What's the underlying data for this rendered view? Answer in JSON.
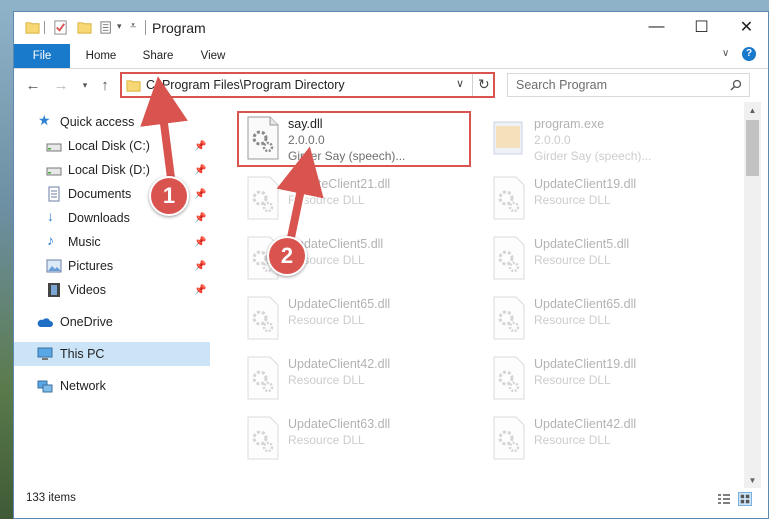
{
  "window": {
    "title": "Program",
    "controls": {
      "minimize": "—",
      "maximize": "☐",
      "close": "✕"
    }
  },
  "ribbon": {
    "tabs": [
      "File",
      "Home",
      "Share",
      "View"
    ]
  },
  "address": {
    "path": "C:\\Program Files\\Program Directory",
    "search_placeholder": "Search Program"
  },
  "sidebar": {
    "items": [
      {
        "label": "Quick access",
        "icon": "star-icon",
        "pinned": false
      },
      {
        "label": "Local Disk (C:)",
        "icon": "drive-icon",
        "pinned": true
      },
      {
        "label": "Local Disk (D:)",
        "icon": "drive-icon",
        "pinned": true
      },
      {
        "label": "Documents",
        "icon": "documents-icon",
        "pinned": true
      },
      {
        "label": "Downloads",
        "icon": "downloads-icon",
        "pinned": true
      },
      {
        "label": "Music",
        "icon": "music-icon",
        "pinned": true
      },
      {
        "label": "Pictures",
        "icon": "pictures-icon",
        "pinned": true
      },
      {
        "label": "Videos",
        "icon": "videos-icon",
        "pinned": true
      },
      {
        "label": "OneDrive",
        "icon": "onedrive-icon",
        "pinned": false
      },
      {
        "label": "This PC",
        "icon": "this-pc-icon",
        "pinned": false
      },
      {
        "label": "Network",
        "icon": "network-icon",
        "pinned": false
      }
    ]
  },
  "files": {
    "highlighted": {
      "name": "say.dll",
      "version": "2.0.0.0",
      "description": "Girder Say (speech)..."
    },
    "program": {
      "name": "program.exe",
      "version": "2.0.0.0",
      "description": "Girder Say (speech)..."
    },
    "grid": [
      {
        "name": "UpdateClient21.dll",
        "desc": "Resource DLL"
      },
      {
        "name": "UpdateClient19.dll",
        "desc": "Resource DLL"
      },
      {
        "name": "UpdateClient5.dll",
        "desc": "Resource DLL"
      },
      {
        "name": "UpdateClient5.dll",
        "desc": "Resource DLL"
      },
      {
        "name": "UpdateClient65.dll",
        "desc": "Resource DLL"
      },
      {
        "name": "UpdateClient65.dll",
        "desc": "Resource DLL"
      },
      {
        "name": "UpdateClient42.dll",
        "desc": "Resource DLL"
      },
      {
        "name": "UpdateClient19.dll",
        "desc": "Resource DLL"
      },
      {
        "name": "UpdateClient63.dll",
        "desc": "Resource DLL"
      },
      {
        "name": "UpdateClient42.dll",
        "desc": "Resource DLL"
      }
    ]
  },
  "status": {
    "item_count": "133 items"
  },
  "callouts": [
    "1",
    "2"
  ],
  "colors": {
    "accent": "#1979ca",
    "highlight": "#d9534f",
    "selected": "#cce4f7"
  }
}
